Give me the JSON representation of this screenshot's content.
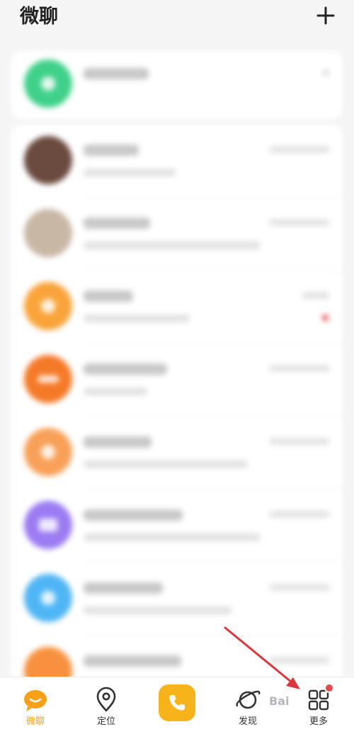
{
  "header": {
    "title": "微聊",
    "add_icon": "plus-icon"
  },
  "colors": {
    "accent": "#f7a01a",
    "call_button": "#f7b31a",
    "notification": "#e5484d",
    "arrow": "#d9363e"
  },
  "conversations": [
    {
      "avatar_color": "#3fd18a",
      "unread": false
    },
    {
      "avatar_color": "#6b4a3f",
      "unread": false
    },
    {
      "avatar_color": "#c9b7a6",
      "unread": false
    },
    {
      "avatar_color": "#f9a43a",
      "unread": true
    },
    {
      "avatar_color": "#f57a28",
      "unread": false
    },
    {
      "avatar_color": "#f8a057",
      "unread": false
    },
    {
      "avatar_color": "#9b7cf2",
      "unread": false
    },
    {
      "avatar_color": "#4fb6f5",
      "unread": false
    },
    {
      "avatar_color": "#f7913e",
      "unread": false
    }
  ],
  "bottom_nav": {
    "items": [
      {
        "label": "微聊",
        "icon": "chat-bubble-icon",
        "active": true
      },
      {
        "label": "定位",
        "icon": "location-pin-icon",
        "active": false
      },
      {
        "label": "",
        "icon": "phone-icon",
        "active": false
      },
      {
        "label": "发现",
        "icon": "planet-icon",
        "active": false
      },
      {
        "label": "更多",
        "icon": "grid-apps-icon",
        "active": false,
        "badge": true
      }
    ]
  },
  "watermark": "Bai"
}
